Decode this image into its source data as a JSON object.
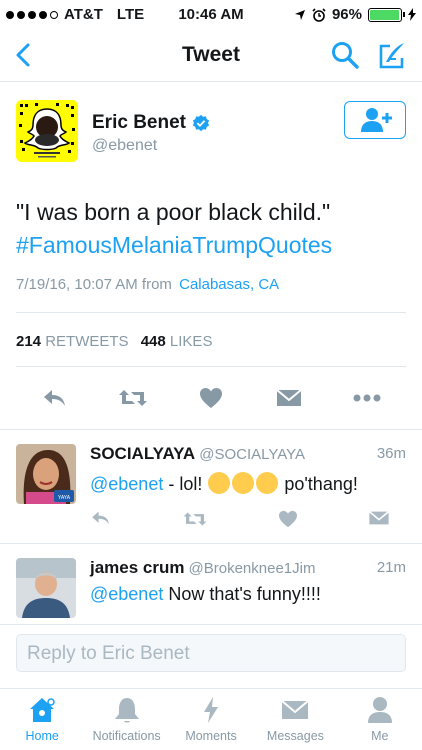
{
  "status_bar": {
    "carrier": "AT&T",
    "network": "LTE",
    "time": "10:46 AM",
    "battery": "96%",
    "battery_level": 0.96
  },
  "nav": {
    "title": "Tweet",
    "back_icon": "chevron-left-icon",
    "search_icon": "search-icon",
    "compose_icon": "compose-icon"
  },
  "tweet": {
    "author_name": "Eric Benet",
    "author_handle": "@ebenet",
    "verified": true,
    "text": "\"I was born a poor black child.\"",
    "hashtag": "#FamousMelaniaTrumpQuotes",
    "timestamp": "7/19/16, 10:07 AM from",
    "location": "Calabasas, CA",
    "retweets_count": "214",
    "retweets_label": "RETWEETS",
    "likes_count": "448",
    "likes_label": "LIKES"
  },
  "replies": [
    {
      "name": "SOCIALYAYA",
      "handle": "@SOCIALYAYA",
      "time": "36m",
      "mention": "@ebenet",
      "text_before_emoji": " - lol! ",
      "text_after_emoji": " po'thang!"
    },
    {
      "name": "james crum",
      "handle": "@Brokenknee1Jim",
      "time": "21m",
      "mention": "@ebenet",
      "text": " Now that's funny!!!!"
    }
  ],
  "composer": {
    "placeholder": "Reply to Eric Benet"
  },
  "tabbar": {
    "tabs": [
      {
        "label": "Home",
        "icon": "home-icon",
        "active": true
      },
      {
        "label": "Notifications",
        "icon": "bell-icon",
        "active": false
      },
      {
        "label": "Moments",
        "icon": "lightning-icon",
        "active": false
      },
      {
        "label": "Messages",
        "icon": "envelope-icon",
        "active": false
      },
      {
        "label": "Me",
        "icon": "person-icon",
        "active": false
      }
    ]
  },
  "colors": {
    "accent": "#1da1f2",
    "muted": "#8899a6",
    "text": "#14171a",
    "snap_yellow": "#fffc00"
  }
}
